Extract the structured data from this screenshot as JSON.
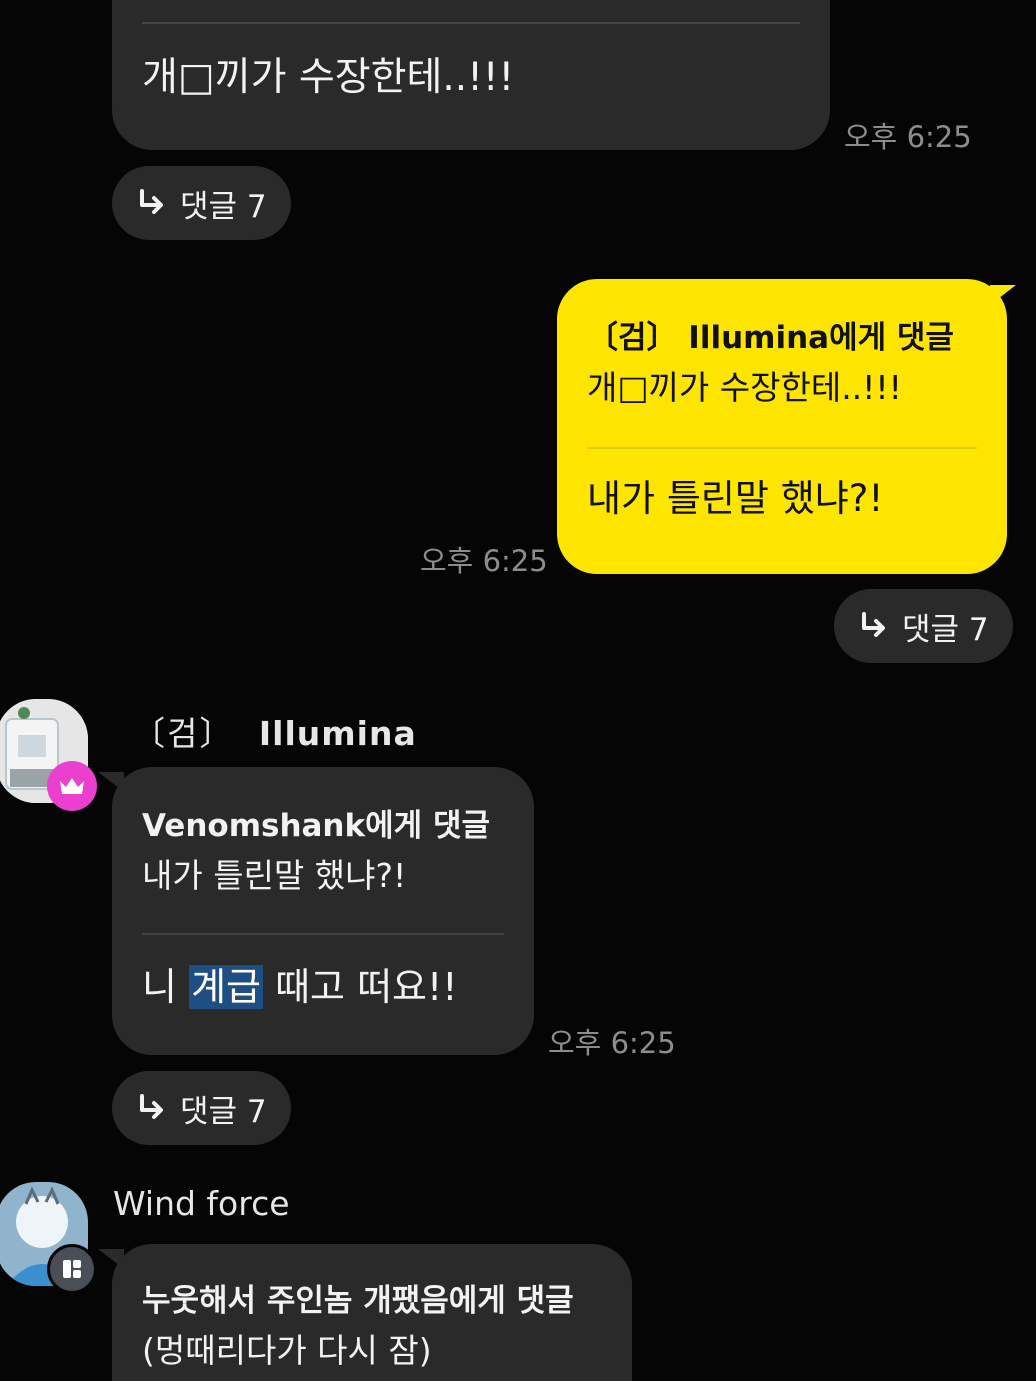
{
  "messages": [
    {
      "main": "개□끼가 수장한테..!!!",
      "time": "오후 6:25",
      "reply_label": "댓글 7"
    },
    {
      "reply_target": "〔검〕 Illumina에게 댓글",
      "quoted": "개□끼가 수장한테..!!!",
      "main": "내가 틀린말 했냐?!",
      "time": "오후 6:25",
      "reply_label": "댓글 7"
    },
    {
      "sender_prefix": "〔검〕",
      "sender_name": "Illumina",
      "reply_target": "Venomshank에게 댓글",
      "quoted": "내가 틀린말 했냐?!",
      "main_before": "니",
      "main_highlight": "계급",
      "main_after": "때고 떠요!!",
      "time": "오후 6:25",
      "reply_label": "댓글 7",
      "badge_icon": "crown-icon"
    },
    {
      "sender_name": "Wind force",
      "reply_target": "누웃해서 주인놈 개팼음에게 댓글",
      "quoted": "(멍때리다가 다시 잠)",
      "badge_icon": "app-badge-icon"
    }
  ],
  "colors": {
    "background": "#050505",
    "bubble_dark": "#2a2a2a",
    "bubble_mine": "#fee500",
    "crown_badge": "#ea3fcf",
    "highlight": "#1d4f84"
  }
}
